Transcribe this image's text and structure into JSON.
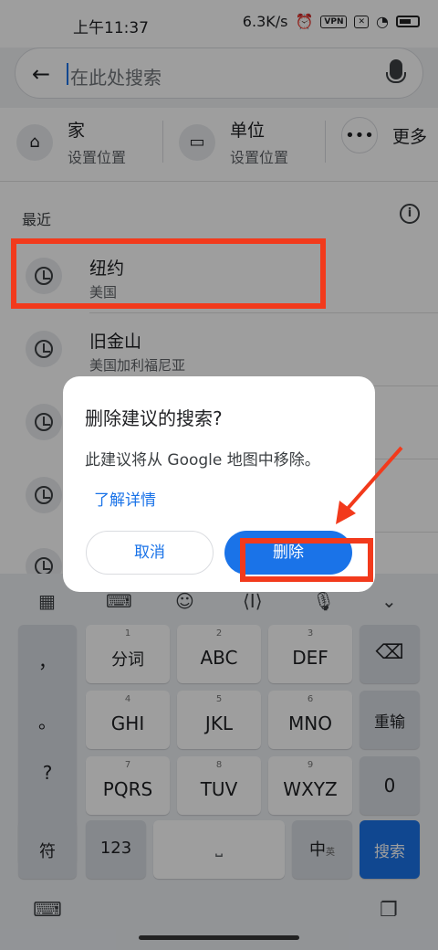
{
  "status_bar": {
    "time": "上午11:37",
    "speed": "6.3K/s",
    "vpn": "VPN"
  },
  "search": {
    "placeholder": "在此处搜索"
  },
  "shortcuts": [
    {
      "title": "家",
      "subtitle": "设置位置",
      "icon": "home-icon"
    },
    {
      "title": "单位",
      "subtitle": "设置位置",
      "icon": "briefcase-icon"
    },
    {
      "title": "更多",
      "icon": "more-horiz-icon"
    }
  ],
  "recent": {
    "title": "最近",
    "items": [
      {
        "name": "纽约",
        "sub": "美国"
      },
      {
        "name": "旧金山",
        "sub": "美国加利福尼亚"
      }
    ]
  },
  "dialog": {
    "title": "删除建议的搜索?",
    "message": "此建议将从 Google 地图中移除。",
    "learn_more": "了解详情",
    "cancel": "取消",
    "delete": "删除"
  },
  "keyboard": {
    "symbols": [
      "，",
      "。",
      "?",
      "!"
    ],
    "rows": [
      [
        {
          "num": "1",
          "label": "分词"
        },
        {
          "num": "2",
          "label": "ABC"
        },
        {
          "num": "3",
          "label": "DEF"
        }
      ],
      [
        {
          "num": "4",
          "label": "GHI"
        },
        {
          "num": "5",
          "label": "JKL"
        },
        {
          "num": "6",
          "label": "MNO"
        }
      ],
      [
        {
          "num": "7",
          "label": "PQRS"
        },
        {
          "num": "8",
          "label": "TUV"
        },
        {
          "num": "9",
          "label": "WXYZ"
        }
      ]
    ],
    "backspace": "⌫",
    "reenter": "重输",
    "zero": "0",
    "fu": "符",
    "num123": "123",
    "zh": "中",
    "en": "英",
    "search": "搜索"
  },
  "colors": {
    "accent": "#1a73e8",
    "annotation": "#f23a1c"
  }
}
